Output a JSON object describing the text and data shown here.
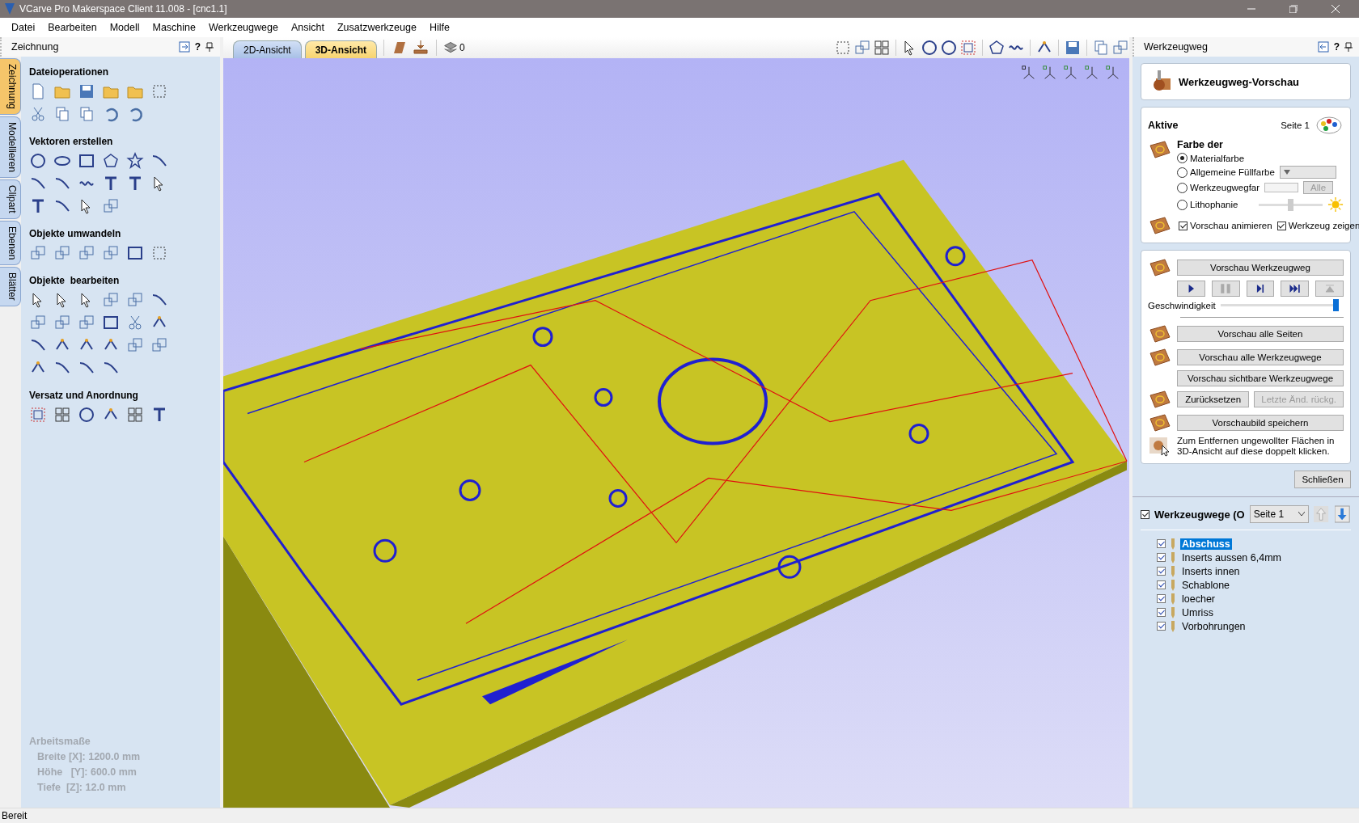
{
  "window": {
    "title": "VCarve Pro Makerspace Client 11.008 - [cnc1.1]"
  },
  "menu": [
    "Datei",
    "Bearbeiten",
    "Modell",
    "Maschine",
    "Werkzeugwege",
    "Ansicht",
    "Zusatzwerkzeuge",
    "Hilfe"
  ],
  "left_panel": {
    "title": "Zeichnung",
    "help": "?",
    "side_tabs": [
      {
        "label": "Zeichnung",
        "selected": true
      },
      {
        "label": "Modellieren",
        "selected": false
      },
      {
        "label": "Clipart",
        "selected": false
      },
      {
        "label": "Ebenen",
        "selected": false
      },
      {
        "label": "Blätter",
        "selected": false
      }
    ],
    "sections": [
      {
        "title": "Dateioperationen"
      },
      {
        "title": "Vektoren erstellen"
      },
      {
        "title": "Objekte umwandeln"
      },
      {
        "title": "Objekte  bearbeiten"
      },
      {
        "title": "Versatz und Anordnung"
      }
    ],
    "dimensions": {
      "title": "Arbeitsmaße",
      "lines": [
        "Breite [X]: 1200.0 mm",
        "Höhe   [Y]: 600.0 mm",
        "Tiefe  [Z]: 12.0 mm"
      ]
    }
  },
  "view_tabs": [
    {
      "label": "2D-Ansicht",
      "selected": false
    },
    {
      "label": "3D-Ansicht",
      "selected": true
    }
  ],
  "layer_value": "0",
  "right_panel": {
    "title": "Werkzeugweg",
    "help": "?",
    "preview_title": "Werkzeugweg-Vorschau",
    "active_label": "Aktive",
    "page_label": "Seite 1",
    "color_heading": "Farbe der",
    "color_options": [
      {
        "label": "Materialfarbe",
        "selected": true
      },
      {
        "label": "Allgemeine Füllfarbe",
        "selected": false
      },
      {
        "label": "Werkzeugwegfar",
        "selected": false
      },
      {
        "label": "Lithophanie",
        "selected": false
      }
    ],
    "all_button": {
      "label": "Alle",
      "disabled": true
    },
    "litho": {
      "level": 0.5
    },
    "checks": [
      {
        "label": "Vorschau animieren",
        "checked": true
      },
      {
        "label": "Werkzeug zeigen",
        "checked": true
      }
    ],
    "preview_button": "Vorschau Werkzeugweg",
    "playback": [
      {
        "kind": "play",
        "disabled": false
      },
      {
        "kind": "pause",
        "disabled": true
      },
      {
        "kind": "step",
        "disabled": false
      },
      {
        "kind": "end",
        "disabled": false
      },
      {
        "kind": "top",
        "disabled": true
      }
    ],
    "speed_label": "Geschwindigkeit",
    "speed": {
      "level": 1
    },
    "buttons": [
      {
        "label": "Vorschau alle Seiten",
        "disabled": false
      },
      {
        "label": "Vorschau alle Werkzeugwege",
        "disabled": false
      },
      {
        "label": "Vorschau sichtbare Werkzeugwege",
        "disabled": false
      },
      {
        "label": "Zurücksetzen",
        "disabled": false
      },
      {
        "label": "Letzte Änd. rückg.",
        "disabled": true
      },
      {
        "label": "Vorschaubild speichern",
        "disabled": false
      }
    ],
    "hint": "Zum Entfernen ungewollter Flächen in 3D-Ansicht auf diese doppelt klicken.",
    "close_button": "Schließen",
    "toolpaths": {
      "checked": true,
      "title": "Werkzeugwege (O",
      "page": "Seite 1",
      "items": [
        {
          "name": "Abschuss",
          "checked": true,
          "selected": true
        },
        {
          "name": "Inserts aussen 6,4mm",
          "checked": true,
          "selected": false
        },
        {
          "name": "Inserts innen",
          "checked": true,
          "selected": false
        },
        {
          "name": "Schablone",
          "checked": true,
          "selected": false
        },
        {
          "name": "loecher",
          "checked": true,
          "selected": false
        },
        {
          "name": "Umriss",
          "checked": true,
          "selected": false
        },
        {
          "name": "Vorbohrungen",
          "checked": true,
          "selected": false
        }
      ]
    }
  },
  "status_bar": "Bereit"
}
